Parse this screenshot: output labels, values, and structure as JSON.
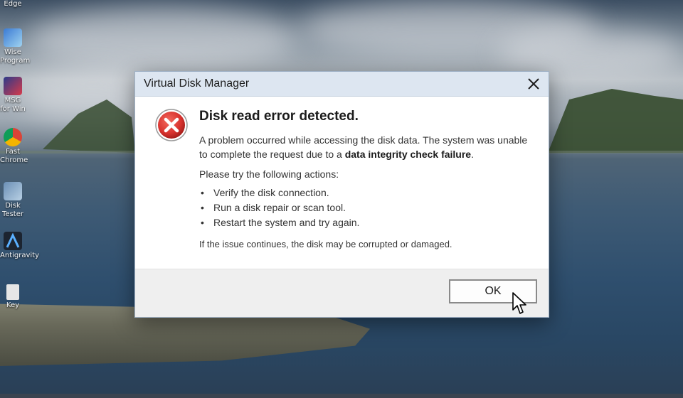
{
  "desktop": {
    "icons": [
      {
        "label": "Edge",
        "name": "edge-shortcut",
        "icon": "edge-icon"
      },
      {
        "label": "Wise Program",
        "name": "wise-program-shortcut",
        "icon": "wise-icon"
      },
      {
        "label": "MSG for Win",
        "name": "msg-shortcut",
        "icon": "msg-icon"
      },
      {
        "label": "Fast Chrome",
        "name": "chrome-shortcut",
        "icon": "chrome-icon"
      },
      {
        "label": "Disk Tester",
        "name": "disk-tester-shortcut",
        "icon": "disk-icon"
      },
      {
        "label": "Antigravity",
        "name": "antigravity-shortcut",
        "icon": "antigravity-icon"
      },
      {
        "label": "Key",
        "name": "key-file-shortcut",
        "icon": "file-icon"
      }
    ]
  },
  "dialog": {
    "title": "Virtual Disk Manager",
    "icon": "error-icon",
    "heading": "Disk read error detected.",
    "message_part1": "A problem occurred while accessing the disk data. The system was unable to complete the request due to a ",
    "message_bold": "data integrity check failure",
    "message_part2": ".",
    "actions_intro": "Please try the following actions:",
    "actions": [
      "Verify the disk connection.",
      "Run a disk repair or scan tool.",
      "Restart the system and try again."
    ],
    "footnote": "If the issue continues, the disk may be corrupted or damaged.",
    "ok_label": "OK"
  },
  "colors": {
    "error_red": "#d8322e",
    "titlebar": "#dde6f1",
    "footer": "#efefef"
  }
}
